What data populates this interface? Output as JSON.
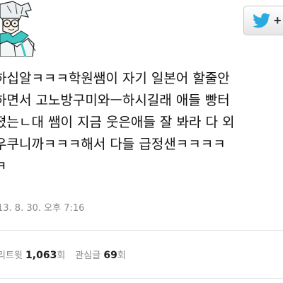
{
  "follow_button": {
    "icon": "twitter-bird-icon",
    "label": "+"
  },
  "avatar": {
    "icon": "anime-character-avatar"
  },
  "tweet": {
    "lines": [
      "하십알ㅋㅋㅋ학원쌤이 자기 일본어 할줄안",
      "하면서 고노방구미와ㅡ하시길래 애들 빵터",
      "졌는ㄴ대 쌤이 지금 웃은애들 잘 봐라 다 외",
      "우쿠니까ㅋㅋㅋ해서 다들 급정샌ㅋㅋㅋㅋ",
      "ㅋ"
    ],
    "timestamp": "13. 8. 30. 오후 7:16"
  },
  "stats": {
    "retweet_label_prefix": "리트윗",
    "retweet_count": "1,063",
    "retweet_unit": "회",
    "favorite_label": "관심글",
    "favorite_count": "69",
    "favorite_unit": "회"
  },
  "colors": {
    "brand_twitter": "#2aa9e0",
    "muted_text": "#8a8a8a"
  }
}
